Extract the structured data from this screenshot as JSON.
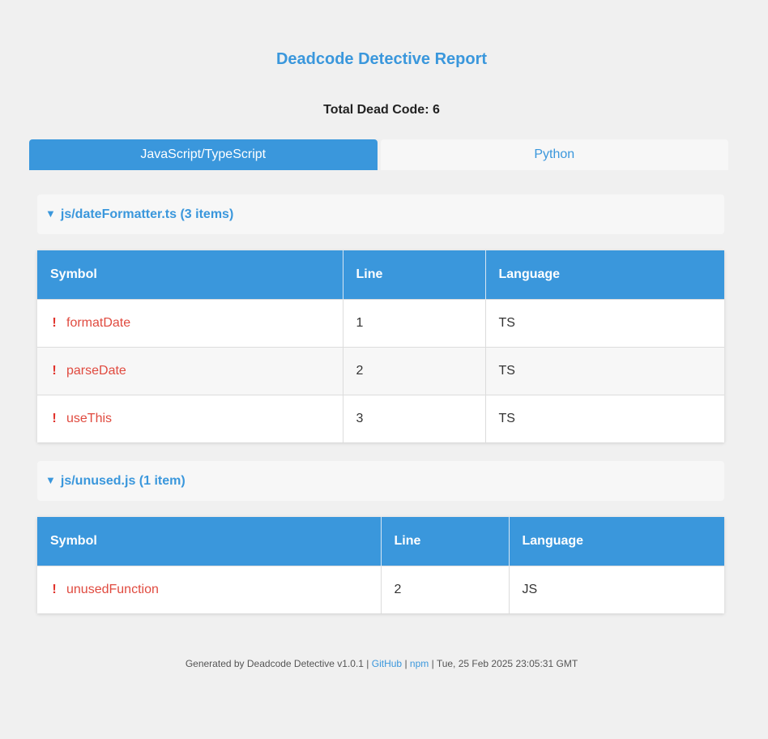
{
  "title": "Deadcode Detective Report",
  "total_label": "Total Dead Code: 6",
  "tabs": [
    {
      "label": "JavaScript/TypeScript",
      "active": true
    },
    {
      "label": "Python",
      "active": false
    }
  ],
  "table_headers": {
    "symbol": "Symbol",
    "line": "Line",
    "language": "Language"
  },
  "files": [
    {
      "header": "js/dateFormatter.ts (3 items)",
      "rows": [
        {
          "icon": "!",
          "symbol": "formatDate",
          "line": "1",
          "language": "TS"
        },
        {
          "icon": "!",
          "symbol": "parseDate",
          "line": "2",
          "language": "TS"
        },
        {
          "icon": "!",
          "symbol": "useThis",
          "line": "3",
          "language": "TS"
        }
      ]
    },
    {
      "header": "js/unused.js (1 item)",
      "rows": [
        {
          "icon": "!",
          "symbol": "unusedFunction",
          "line": "2",
          "language": "JS"
        }
      ]
    }
  ],
  "caret": "▼",
  "footer": {
    "prefix": "Generated by Deadcode Detective v1.0.1 | ",
    "github": "GitHub",
    "sep1": " | ",
    "npm": "npm",
    "suffix": " | Tue, 25 Feb 2025 23:05:31 GMT"
  },
  "colors": {
    "accent": "#3a97dc",
    "warning": "#e04a3f",
    "background": "#f0f0f0"
  }
}
